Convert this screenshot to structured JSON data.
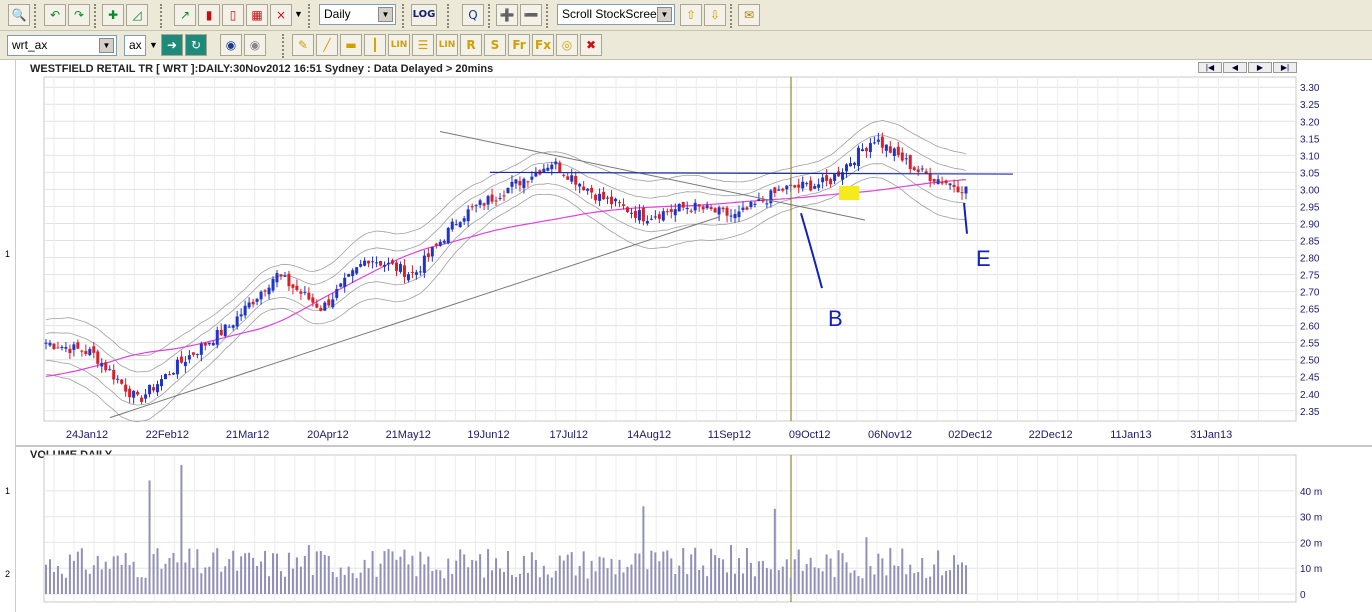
{
  "toolbar1": {
    "interval": "Daily",
    "log_label": "LOG",
    "scroll_mode": "Scroll StockScreen"
  },
  "toolbar2": {
    "symbol": "wrt_ax",
    "exchange": "ax",
    "tool_buttons": [
      "LIN",
      "LIN",
      "R",
      "S",
      "Fr",
      "Fx"
    ]
  },
  "chart_header": "WESTFIELD RETAIL TR [ WRT ]:DAILY:30Nov2012 16:51 Sydney : Data Delayed > 20mins",
  "volume_header": "VOLUME DAILY",
  "left_markers": {
    "price_pane": "1",
    "vol_pane_a": "1",
    "vol_pane_b": "2"
  },
  "annotations": {
    "b": "B",
    "e": "E"
  },
  "chart_data": [
    {
      "type": "candlestick",
      "title": "WESTFIELD RETAIL TR [ WRT ]:DAILY:30Nov2012 16:51 Sydney : Data Delayed > 20mins",
      "x_tick_labels": [
        "24Jan12",
        "22Feb12",
        "21Mar12",
        "20Apr12",
        "21May12",
        "19Jun12",
        "17Jul12",
        "14Aug12",
        "11Sep12",
        "09Oct12",
        "06Nov12",
        "02Dec12",
        "22Dec12",
        "11Jan13",
        "31Jan13"
      ],
      "y_tick_labels": [
        "3.30",
        "3.25",
        "3.20",
        "3.15",
        "3.10",
        "3.05",
        "3.00",
        "2.95",
        "2.90",
        "2.85",
        "2.80",
        "2.75",
        "2.70",
        "2.65",
        "2.60",
        "2.55",
        "2.50",
        "2.45",
        "2.40",
        "2.35"
      ],
      "ylim": [
        2.32,
        3.33
      ],
      "approx_close_series": [
        [
          "Jan12",
          2.55
        ],
        [
          "Feb12 early",
          2.52
        ],
        [
          "22Feb12",
          2.38
        ],
        [
          "Mar12",
          2.5
        ],
        [
          "Apr12",
          2.6
        ],
        [
          "May12",
          2.75
        ],
        [
          "21May12",
          2.65
        ],
        [
          "Jun12",
          2.8
        ],
        [
          "19Jun12",
          2.75
        ],
        [
          "Jul12",
          2.92
        ],
        [
          "17Jul12",
          3.0
        ],
        [
          "Aug12",
          3.08
        ],
        [
          "14Aug12",
          2.98
        ],
        [
          "Sep12",
          2.92
        ],
        [
          "11Sep12",
          2.95
        ],
        [
          "Oct12",
          2.92
        ],
        [
          "09Oct12",
          3.0
        ],
        [
          "Oct12 late",
          3.02
        ],
        [
          "06Nov12",
          3.15
        ],
        [
          "Nov12 late",
          3.05
        ],
        [
          "30Nov12",
          3.0
        ]
      ],
      "horizontal_line": 3.05,
      "colors": {
        "up": "#1f35c8",
        "down": "#d6202a",
        "ma": "#e040e0",
        "bands": "#a0a0a0",
        "trend": "#777777",
        "resistance": "#1a2c9c",
        "marker": "#807000"
      }
    },
    {
      "type": "bar",
      "title": "VOLUME DAILY",
      "y_tick_labels": [
        "40 m",
        "30 m",
        "20 m",
        "10 m",
        "0"
      ],
      "ylim": [
        0,
        50
      ],
      "color": "#9090b8"
    }
  ]
}
